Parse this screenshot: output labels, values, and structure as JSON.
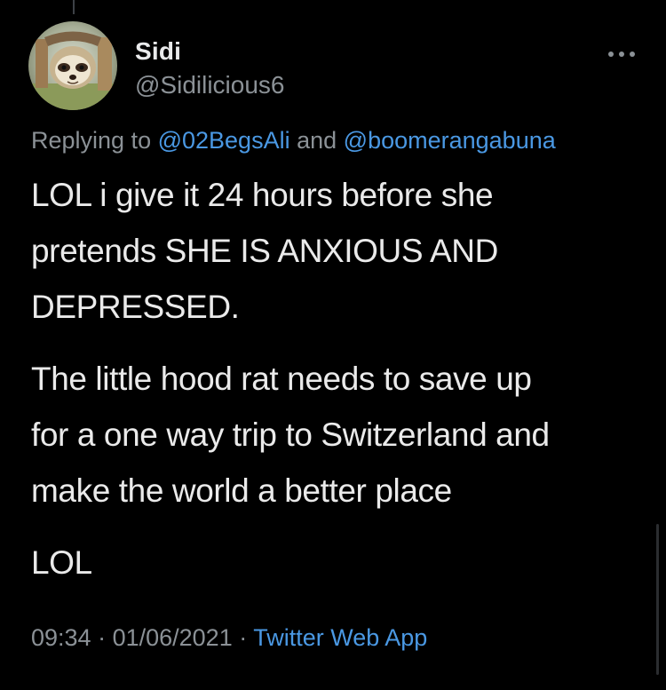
{
  "tweet": {
    "display_name": "Sidi",
    "handle": "@Sidilicious6",
    "replying_prefix": "Replying to ",
    "reply_mentions": [
      "@02BegsAli",
      "@boomerangabuna"
    ],
    "reply_joiner": " and ",
    "paragraphs": [
      [
        "LOL i give it 24 hours before she",
        "pretends SHE IS ANXIOUS AND",
        "DEPRESSED."
      ],
      [
        "The little hood rat needs to save up",
        "for a one way trip to Switzerland and",
        "make the world a better place"
      ],
      [
        "LOL"
      ]
    ],
    "time": "09:34",
    "date": "01/06/2021",
    "separator": " · ",
    "source": "Twitter Web App"
  },
  "icons": {
    "more": "more-horizontal-icon",
    "avatar": "sloth-avatar"
  },
  "colors": {
    "background": "#000000",
    "text": "#eaeaea",
    "secondary": "#8b9196",
    "link": "#4a98e3"
  }
}
